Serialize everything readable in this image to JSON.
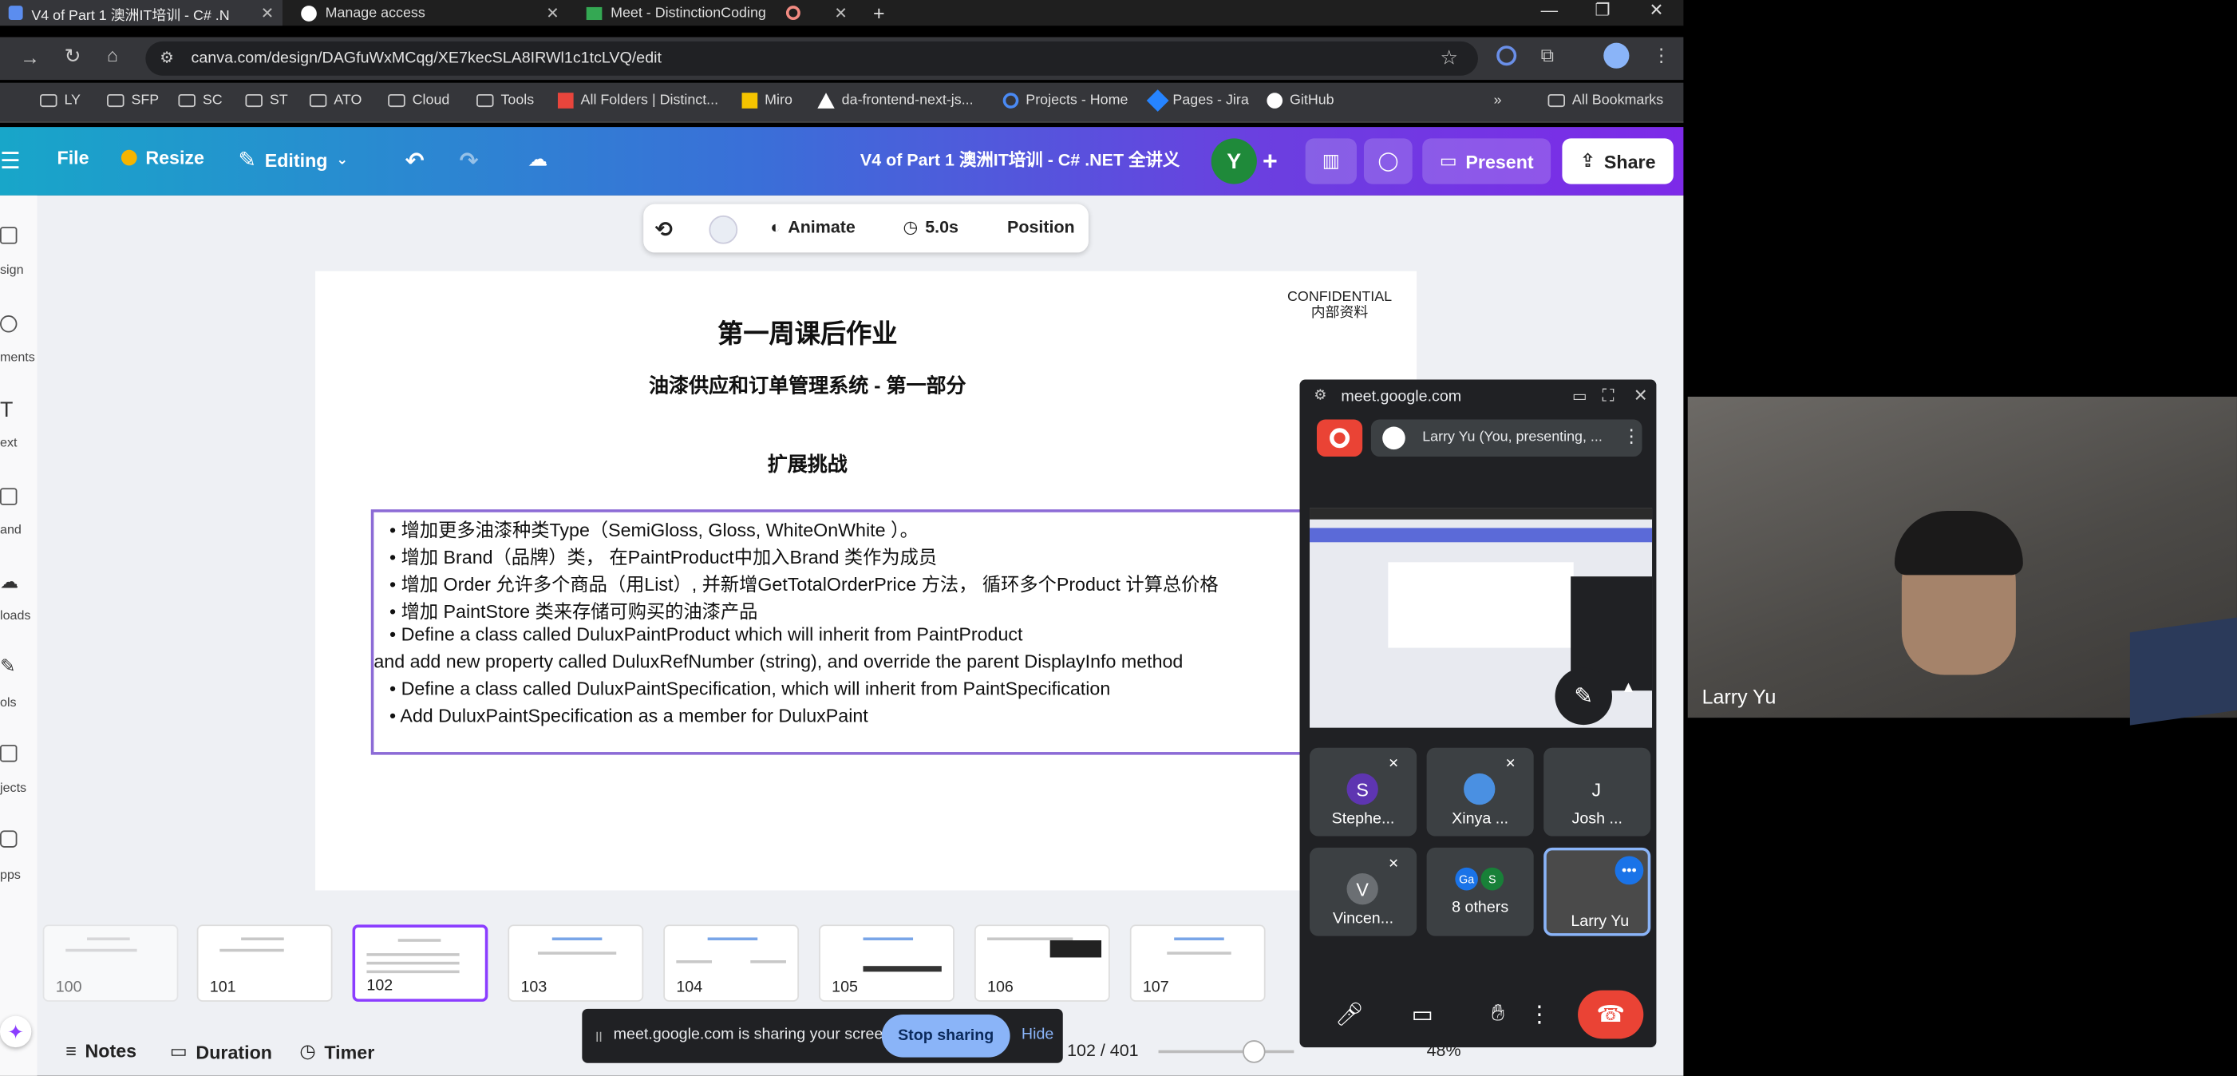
{
  "browser": {
    "tabs": [
      {
        "title": "V4 of Part 1 澳洲IT培训 - C# .N",
        "active": true
      },
      {
        "title": "Manage access",
        "active": false
      },
      {
        "title": "Meet - DistinctionCoding",
        "active": false
      }
    ],
    "new_tab": "+",
    "url": "canva.com/design/DAGfuWxMCqg/XE7kecSLA8IRWl1c1tcLVQ/edit",
    "bookmarks": [
      "LY",
      "SFP",
      "SC",
      "ST",
      "ATO",
      "Cloud",
      "Tools",
      "All Folders | Distinct...",
      "Miro",
      "da-frontend-next-js...",
      "Projects - Home",
      "Pages - Jira",
      "GitHub"
    ],
    "more_bookmarks": "»",
    "all_bookmarks": "All Bookmarks"
  },
  "canva": {
    "file_label": "File",
    "resize_label": "Resize",
    "editing_label": "Editing",
    "doc_title": "V4 of Part 1 澳洲IT培训 - C# .NET 全讲义",
    "avatar_letter": "Y",
    "present_label": "Present",
    "share_label": "Share",
    "left_nav": [
      "sign",
      "ments",
      "ext",
      "and",
      "loads",
      "ols",
      "jects",
      "pps"
    ],
    "toolbar": {
      "animate": "Animate",
      "duration": "5.0s",
      "position": "Position"
    },
    "slide": {
      "confidential_line1": "CONFIDENTIAL",
      "confidential_line2": "内部资料",
      "title": "第一周课后作业",
      "subtitle": "油漆供应和订单管理系统 - 第一部分",
      "section": "扩展挑战",
      "lines": [
        "•  增加更多油漆种类Type（SemiGloss, Gloss, WhiteOnWhite ）。",
        "•  增加 Brand（品牌）类， 在PaintProduct中加入Brand 类作为成员",
        "•  增加 Order 允许多个商品（用List）, 并新增GetTotalOrderPrice 方法， 循环多个Product 计算总价格",
        "•  增加 PaintStore 类来存储可购买的油漆产品",
        "•  Define a class called DuluxPaintProduct which will inherit from PaintProduct",
        "and add new property called DuluxRefNumber (string), and override the parent DisplayInfo method",
        "•  Define a class called DuluxPaintSpecification, which will inherit from PaintSpecification",
        "•  Add DuluxPaintSpecification as a member for DuluxPaint"
      ]
    },
    "thumbnails": [
      "100",
      "101",
      "102",
      "103",
      "104",
      "105",
      "106",
      "107"
    ],
    "selected_thumbnail": "102",
    "bottom": {
      "notes": "Notes",
      "duration": "Duration",
      "timer": "Timer",
      "page": "102 / 401",
      "zoom": "48%"
    }
  },
  "screen_share_bar": {
    "message": "meet.google.com is sharing your screen.",
    "stop_label": "Stop sharing",
    "hide_label": "Hide"
  },
  "meet_pip": {
    "url": "meet.google.com",
    "presenter": "Larry Yu (You, presenting, ...",
    "participants": [
      {
        "initial": "S",
        "name": "Stephe...",
        "color": "#5e35b1"
      },
      {
        "initial": "",
        "name": "Xinya ...",
        "color": "#4a90e2"
      },
      {
        "initial": "J",
        "name": "Josh ...",
        "color": "#3c4043"
      },
      {
        "initial": "V",
        "name": "Vincen...",
        "color": "#6b6f73"
      },
      {
        "initial": "",
        "name": "8 others",
        "color": "#3c4043"
      },
      {
        "initial": "",
        "name": "Larry Yu",
        "color": "#4a4a4a"
      }
    ],
    "others_badges": [
      "Ga",
      "S"
    ]
  },
  "camera": {
    "name": "Larry Yu"
  },
  "colors": {
    "accent_purple": "#8b3dff",
    "meet_red": "#ea4335",
    "share_blue": "#8ab4f8"
  }
}
